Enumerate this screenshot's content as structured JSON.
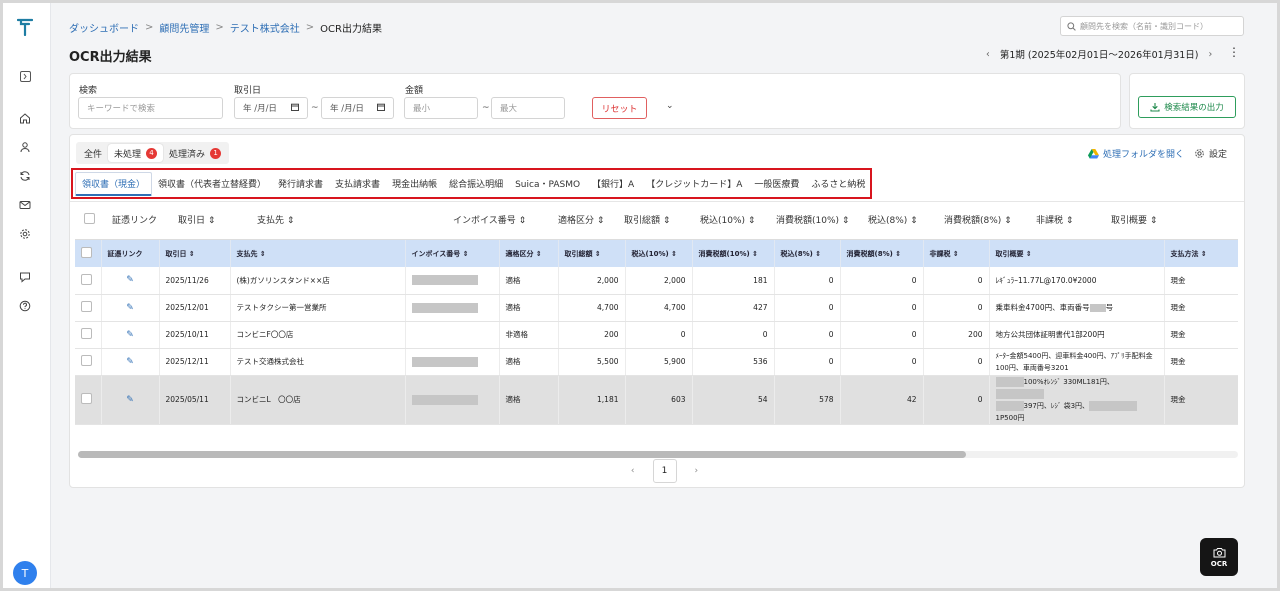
{
  "breadcrumb": [
    {
      "label": "ダッシュボード"
    },
    {
      "label": "顧問先管理"
    },
    {
      "label": "テスト株式会社"
    },
    {
      "label": "OCR出力結果"
    }
  ],
  "breadcrumb_sep": ">",
  "client_search": {
    "placeholder": "顧問先を検索（名前・識別コード）"
  },
  "page_title": "OCR出力結果",
  "period": {
    "label": "第1期 (2025年02月01日〜2026年01月31日)",
    "prev": "‹",
    "next": "›"
  },
  "more": "⋮",
  "filters": {
    "keyword": {
      "label": "検索",
      "placeholder": "キーワードで検索"
    },
    "date": {
      "label": "取引日",
      "from": "年 /月/日",
      "to": "年 /月/日"
    },
    "amount": {
      "label": "金額",
      "min_placeholder": "最小",
      "max_placeholder": "最大"
    },
    "tilde": "~",
    "reset": "リセット",
    "expand": "⌄"
  },
  "export": {
    "label": "検索結果の出力"
  },
  "status_tabs": [
    {
      "label": "全件",
      "badge": ""
    },
    {
      "label": "未処理",
      "badge": "4"
    },
    {
      "label": "処理済み",
      "badge": "1"
    }
  ],
  "folder_link": "処理フォルダを開く",
  "settings": "設定",
  "category_tabs": [
    "領収書（現金）",
    "領収書（代表者立替経費）",
    "発行請求書",
    "支払請求書",
    "現金出納帳",
    "総合振込明細",
    "Suica・PASMO",
    "【銀行】A",
    "【クレジットカード】A",
    "一般医療費",
    "ふるさと納税"
  ],
  "column_header_row": [
    "証憑リンク",
    "取引日 ⇕",
    "支払先 ⇕",
    "インボイス番号 ⇕",
    "適格区分 ⇕",
    "取引総額 ⇕",
    "税込(10%) ⇕",
    "消費税額(10%) ⇕",
    "税込(8%) ⇕",
    "消費税額(8%) ⇕",
    "非課税 ⇕",
    "取引概要 ⇕"
  ],
  "table": {
    "headers": [
      "証憑リンク",
      "取引日 ⇕",
      "支払先 ⇕",
      "インボイス番号 ⇕",
      "適格区分 ⇕",
      "取引総額 ⇕",
      "税込(10%) ⇕",
      "消費税額(10%) ⇕",
      "税込(8%) ⇕",
      "消費税額(8%) ⇕",
      "非課税 ⇕",
      "取引概要 ⇕",
      "支払方法 ⇕"
    ],
    "rows": [
      {
        "date": "2025/11/26",
        "payee": "(株)ガソリンスタンド××店",
        "qual": "適格",
        "total": "2,000",
        "t10": "2,000",
        "c10": "181",
        "t8": "0",
        "c8": "0",
        "exempt": "0",
        "summary": "ﾚｷﾞｭﾗｰ11.77L@170.0¥2000",
        "pay": "現金"
      },
      {
        "date": "2025/12/01",
        "payee": "テストタクシー第一営業所",
        "qual": "適格",
        "total": "4,700",
        "t10": "4,700",
        "c10": "427",
        "t8": "0",
        "c8": "0",
        "exempt": "0",
        "summary": "乗車料金4700円、車両番号",
        "summary_tail": "号",
        "pay": "現金"
      },
      {
        "date": "2025/10/11",
        "payee": "コンビニF〇〇店",
        "qual": "非適格",
        "total": "200",
        "t10": "0",
        "c10": "0",
        "t8": "0",
        "c8": "0",
        "exempt": "200",
        "summary": "地方公共団体証明書代1部200円",
        "pay": "現金"
      },
      {
        "date": "2025/12/11",
        "payee": "テスト交通株式会社",
        "qual": "適格",
        "total": "5,500",
        "t10": "5,900",
        "c10": "536",
        "t8": "0",
        "c8": "0",
        "exempt": "0",
        "summary": "ﾒｰﾀｰ金額5400円、迎車料金400円、ｱﾌﾟﾘ手配料金100円、車両番号3201",
        "pay": "現金"
      },
      {
        "date": "2025/05/11",
        "payee": "コンビニL　〇〇店",
        "qual": "適格",
        "total": "1,181",
        "t10": "603",
        "c10": "54",
        "t8": "578",
        "c8": "42",
        "exempt": "0",
        "summary": "100%ｵﾚﾝｼﾞ 330ML181円、",
        "summary2": "397円、ﾚｼﾞ 袋3円、",
        "summary3": "1P500円",
        "pay": "現金"
      }
    ]
  },
  "pagination": {
    "prev": "‹",
    "page": "1",
    "next": "›"
  },
  "ocr_button": {
    "label": "OCR"
  },
  "user_avatar": "T",
  "colors": {
    "accent": "#2f6fb5",
    "danger": "#d8151e",
    "export_green": "#1f8a4c",
    "table_header": "#cfe0f7"
  }
}
